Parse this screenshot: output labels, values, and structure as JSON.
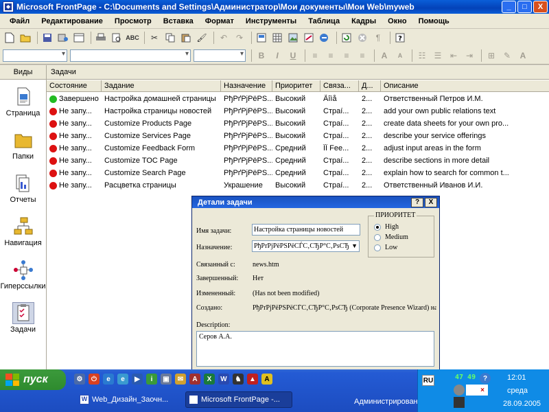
{
  "window": {
    "title": "Microsoft FrontPage - C:\\Documents and Settings\\Администратор\\Мои документы\\Мои Web\\myweb",
    "min_label": "_",
    "max_label": "□",
    "close_label": "X"
  },
  "menu": [
    "Файл",
    "Редактирование",
    "Просмотр",
    "Вставка",
    "Формат",
    "Инструменты",
    "Таблица",
    "Кадры",
    "Окно",
    "Помощь"
  ],
  "toolbar2": {
    "bold": "B",
    "italic": "I",
    "underline": "U"
  },
  "views": {
    "header": "Виды",
    "items": [
      {
        "label": "Страница",
        "icon": "page-icon"
      },
      {
        "label": "Папки",
        "icon": "folder-icon"
      },
      {
        "label": "Отчеты",
        "icon": "reports-icon"
      },
      {
        "label": "Навигация",
        "icon": "navigation-icon"
      },
      {
        "label": "Гиперссылки",
        "icon": "hyperlinks-icon"
      },
      {
        "label": "Задачи",
        "icon": "tasks-icon"
      }
    ]
  },
  "tasks": {
    "header": "Задачи",
    "columns": [
      "Состояние",
      "Задание",
      "Назначение",
      "Приоритет",
      "Связа...",
      "Д...",
      "Описание"
    ],
    "rows": [
      {
        "status": "Завершено",
        "task": "Настройка домашней страницы",
        "assigned": "РђРґРјРёРЅ...",
        "priority": "Высокий",
        "linked": "Ãîìå",
        "date": "2...",
        "desc": "Ответственный Петров И.М.",
        "color": "#22bb22"
      },
      {
        "status": "Не запу...",
        "task": "Настройка страницы новостей",
        "assigned": "РђРґРјРёРЅ...",
        "priority": "Высокий",
        "linked": "Страí...",
        "date": "2...",
        "desc": "add your own public relations text",
        "color": "#dd1111"
      },
      {
        "status": "Не запу...",
        "task": "Customize Products Page",
        "assigned": "РђРґРјРёРЅ...",
        "priority": "Высокий",
        "linked": "Страí...",
        "date": "2...",
        "desc": "create data sheets for your own pro...",
        "color": "#dd1111"
      },
      {
        "status": "Не запу...",
        "task": "Customize Services Page",
        "assigned": "РђРґРјРёРЅ...",
        "priority": "Высокий",
        "linked": "Страí...",
        "date": "2...",
        "desc": "describe your service offerings",
        "color": "#dd1111"
      },
      {
        "status": "Не запу...",
        "task": "Customize Feedback Form",
        "assigned": "РђРґРјРёРЅ...",
        "priority": "Средний",
        "linked": "ÎÎ Fee...",
        "date": "2...",
        "desc": "adjust input areas in the form",
        "color": "#dd1111"
      },
      {
        "status": "Не запу...",
        "task": "Customize TOC Page",
        "assigned": "РђРґРјРёРЅ...",
        "priority": "Средний",
        "linked": "Страí...",
        "date": "2...",
        "desc": "describe sections in more detail",
        "color": "#dd1111"
      },
      {
        "status": "Не запу...",
        "task": "Customize Search Page",
        "assigned": "РђРґРјРёРЅ...",
        "priority": "Средний",
        "linked": "Страí...",
        "date": "2...",
        "desc": "explain how to search for common t...",
        "color": "#dd1111"
      },
      {
        "status": "Не запу...",
        "task": "Расцветка страницы",
        "assigned": "Украшение",
        "priority": "Высокий",
        "linked": "Страí...",
        "date": "2...",
        "desc": "Ответственный Иванов И.И.",
        "color": "#dd1111"
      }
    ]
  },
  "dialog": {
    "title": "Детали задачи",
    "help_label": "?",
    "close_label": "X",
    "name_label": "Имя задачи:",
    "name_value": "Настройка страницы новостей",
    "assigned_label": "Назначение:",
    "assigned_value": "РђРґРјРёРЅРёСЃС‚СЂР°С‚РѕСЂ",
    "linked_label": "Связанный с:",
    "linked_value": "news.htm",
    "completed_label": "Завершенный:",
    "completed_value": "Нет",
    "modified_label": "Измененный:",
    "modified_value": "(Has not been modified)",
    "created_label": "Создано:",
    "created_value": "РђРґРјРёРЅРёСЃС‚СЂР°С‚РѕСЂ (Corporate Presence Wizard) на",
    "priority_legend": "ПРИОРИТЕТ",
    "priority_options": [
      "High",
      "Medium",
      "Low"
    ],
    "priority_selected": "High",
    "description_label": "Description:",
    "description_value": "Серов А.А."
  },
  "taskbar": {
    "start_label": "пуск",
    "tasks": [
      "Web_Дизайн_Заочн...",
      "Microsoft FrontPage -..."
    ],
    "user": "Администрирование",
    "lang": "RU",
    "time": "12:01",
    "day": "среда",
    "date": "28.09.2005",
    "net_counter": "47 49"
  }
}
